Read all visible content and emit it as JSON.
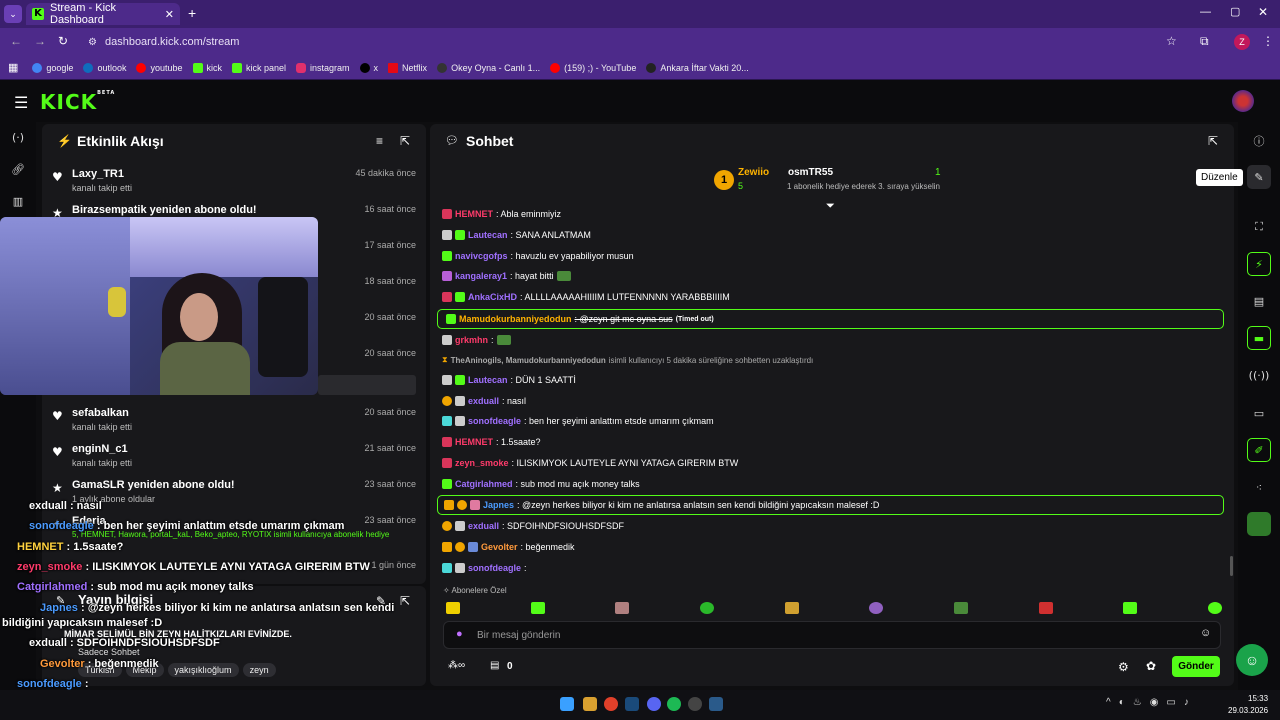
{
  "browser": {
    "tab_title": "Stream - Kick Dashboard",
    "url": "dashboard.kick.com/stream",
    "profile_initial": "Z",
    "bookmarks": [
      {
        "label": "google",
        "color": "#4285f4"
      },
      {
        "label": "outlook",
        "color": "#0f6cbd"
      },
      {
        "label": "youtube",
        "color": "#ff0000"
      },
      {
        "label": "kick",
        "color": "#53fc18"
      },
      {
        "label": "kick panel",
        "color": "#53fc18"
      },
      {
        "label": "instagram",
        "color": "#e1306c"
      },
      {
        "label": "x",
        "color": "#000000"
      },
      {
        "label": "Netflix",
        "color": "#e50914"
      },
      {
        "label": "Okey Oyna - Canlı 1...",
        "color": "#333333"
      },
      {
        "label": "(159) ;) - YouTube",
        "color": "#ff0000"
      },
      {
        "label": "Ankara İftar Vakti 20...",
        "color": "#222222"
      }
    ]
  },
  "app": {
    "logo": "KICK",
    "logo_beta": "BETA",
    "accent": "#53fc18"
  },
  "activity": {
    "title": "Etkinlik Akışı",
    "items": [
      {
        "name": "Laxy_TR1",
        "sub": "kanalı takip etti",
        "time": "45 dakika önce"
      },
      {
        "name": "Birazsempatik yeniden abone oldu!",
        "sub": "",
        "time": "16 saat önce"
      },
      {
        "name": "",
        "sub": "",
        "time": "17 saat önce"
      },
      {
        "name": "",
        "sub": "",
        "time": "18 saat önce"
      },
      {
        "name": "",
        "sub": "",
        "time": "20 saat önce"
      },
      {
        "name": "",
        "sub": "",
        "time": "20 saat önce"
      },
      {
        "name": "sefabalkan",
        "sub": "kanalı takip etti",
        "time": "20 saat önce"
      },
      {
        "name": "enginN_c1",
        "sub": "kanalı takip etti",
        "time": "21 saat önce"
      },
      {
        "name": "GamaSLR yeniden abone oldu!",
        "sub": "1 aylık abone oldular",
        "time": "23 saat önce"
      },
      {
        "name": "Ederia",
        "sub": "5, HEMNET, Hawora, portaL_kaL, Beko_apteo, RYOTIX isimli kullanıcıya abonelik hediye",
        "time": "23 saat önce"
      },
      {
        "name": "",
        "sub": "",
        "time": "1 gün önce"
      }
    ]
  },
  "stream_info": {
    "title": "Yayın bilgisi",
    "stream_title": "MİMAR SELİMÜL BİN ZEYN HALİTKIZLARI EVİNİZDE.",
    "mode": "Sadece Sohbet",
    "tags": [
      "Türkish",
      "Mekip",
      "yakışıklıoğlum",
      "zeyn"
    ]
  },
  "overlay_chat": [
    {
      "user": "exduall",
      "text": " : nasıl",
      "color": "#ffffff"
    },
    {
      "user": "sonofdeagle",
      "text": " : ben her şeyimi anlattım etsde umarım çıkmam",
      "color": "#4b9bff"
    },
    {
      "user": "HEMNET",
      "text": " : 1.5saate?",
      "color": "#ffd23f"
    },
    {
      "user": "zeyn_smoke",
      "text": " : ILISKIMYOK LAUTEYLE AYNI YATAGA GIRERIM BTW",
      "color": "#ff3b6b"
    },
    {
      "user": "Catgirlahmed",
      "text": " : sub mod mu açık money talks",
      "color": "#a070ff"
    },
    {
      "user": "Japnes",
      "text": " : @zeyn herkes biliyor ki kim ne anlatırsa anlatsın sen kendi bildiğini yapıcaksın malesef :D",
      "color": "#4b9bff"
    },
    {
      "user": "exduall",
      "text": " : SDFOIHNDFSIOUHSDFSDF",
      "color": "#ffffff"
    },
    {
      "user": "Gevolter",
      "text": " : beğenmedik",
      "color": "#ff9a3c"
    },
    {
      "user": "sonofdeagle",
      "text": " : ",
      "color": "#4b9bff"
    }
  ],
  "chat": {
    "title": "Sohbet",
    "top_gifter_rank": "1",
    "top_gifter": "Zewiio",
    "top_gifter_count": "5",
    "gifter2": "osmTR55",
    "gifter2_count": "1",
    "gifter2_note": "1 abonelik hediye ederek 3. sıraya yükselin",
    "messages": [
      {
        "user": "HEMNET",
        "text": ": Abla eminmiyiz",
        "color": "#ff3b6b"
      },
      {
        "user": "Lautecan",
        "text": ": SANA ANLATMAM",
        "color": "#a070ff"
      },
      {
        "user": "navivcgofps",
        "text": ": havuzlu ev yapabiliyor musun",
        "color": "#a070ff"
      },
      {
        "user": "kangaleray1",
        "text": ": hayat bitti",
        "color": "#a070ff"
      },
      {
        "user": "AnkaCixHD",
        "text": ": ALLLLAAAAAHIIIIM LUTFENNNNN YARABBBIIIIM",
        "color": "#a070ff"
      },
      {
        "user": "Mamudokurbanniyedodun",
        "text": ": @zeyn git mc oyna sus",
        "color": "#ffb300",
        "note": "(Timed out)"
      },
      {
        "user": "grkmhn",
        "text": ":",
        "color": "#ff3b6b"
      },
      {
        "user": "TheAninogils, Mamudokurbanniyedodun",
        "text": "isimli kullanıcıyı 5 dakika süreliğine sohbetten uzaklaştırdı",
        "color": "#aaaaaa"
      },
      {
        "user": "Lautecan",
        "text": ": DÜN 1 SAATTİ",
        "color": "#a070ff"
      },
      {
        "user": "exduall",
        "text": ": nasıl",
        "color": "#a070ff"
      },
      {
        "user": "sonofdeagle",
        "text": ": ben her şeyimi anlattım etsde umarım çıkmam",
        "color": "#a070ff"
      },
      {
        "user": "HEMNET",
        "text": ": 1.5saate?",
        "color": "#ff3b6b"
      },
      {
        "user": "zeyn_smoke",
        "text": ": ILISKIMYOK LAUTEYLE AYNI YATAGA GIRERIM BTW",
        "color": "#ff3b6b"
      },
      {
        "user": "Catgirlahmed",
        "text": ": sub mod mu açık money talks",
        "color": "#a070ff"
      },
      {
        "user": "Japnes",
        "text": ": @zeyn herkes biliyor ki kim ne anlatırsa anlatsın sen kendi bildiğini yapıcaksın malesef :D",
        "color": "#4b9bff"
      },
      {
        "user": "exduall",
        "text": ": SDFOIHNDFSIOUHSDFSDF",
        "color": "#a070ff"
      },
      {
        "user": "Gevolter",
        "text": ": beğenmedik",
        "color": "#ff9a3c"
      },
      {
        "user": "sonofdeagle",
        "text": ":",
        "color": "#a070ff"
      }
    ],
    "emote_section": "Abonelere Özel",
    "input_placeholder": "Bir mesaj gönderin",
    "points": "0",
    "send_label": "Gönder",
    "tooltip": "Düzenle"
  },
  "taskbar": {
    "time": "15:33",
    "date": "29.03.2026"
  }
}
